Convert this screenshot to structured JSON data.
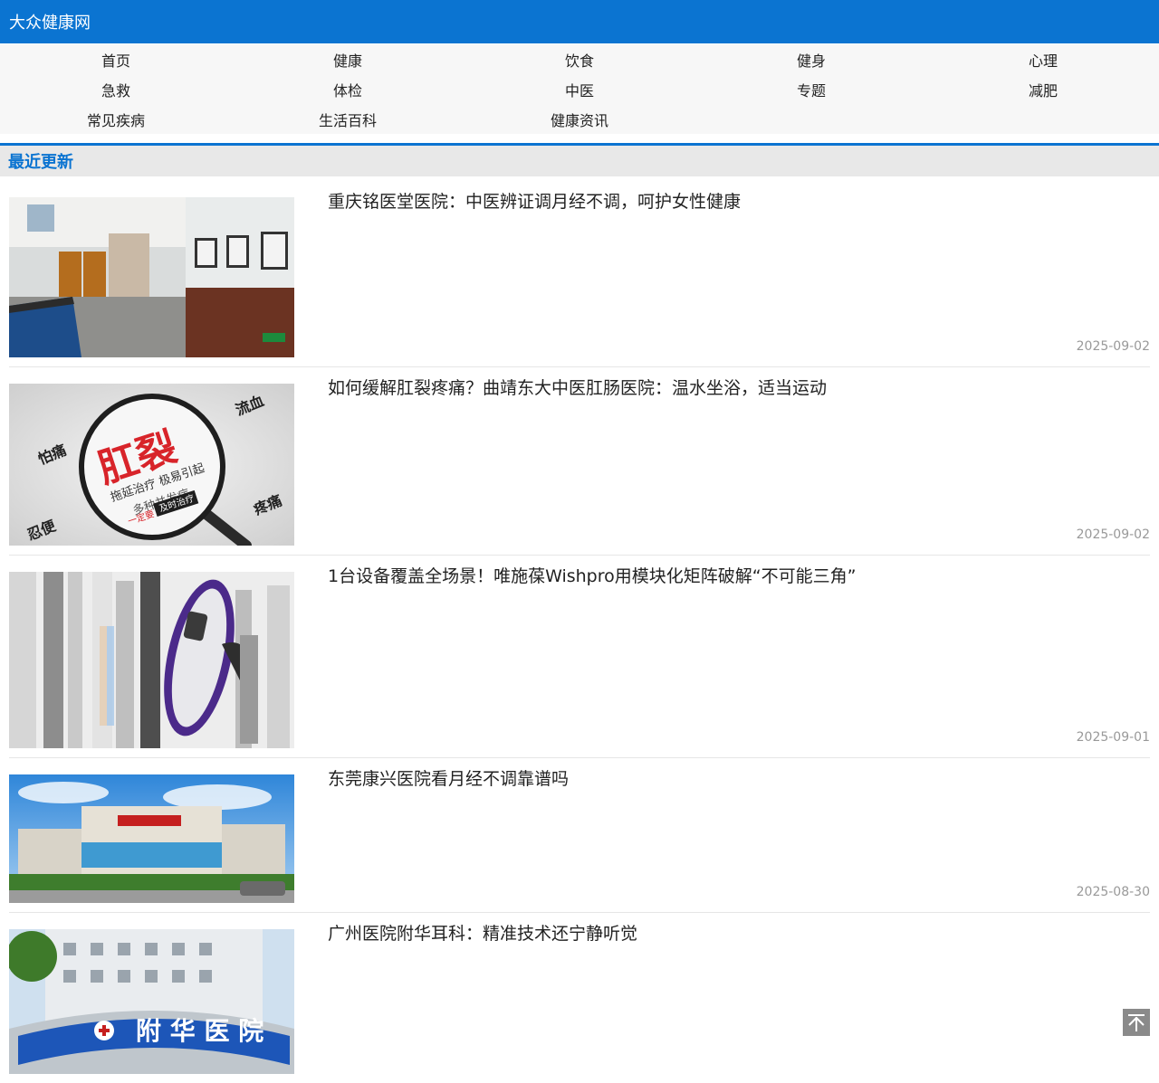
{
  "site": {
    "title": "大众健康网"
  },
  "nav": {
    "items": [
      "首页",
      "健康",
      "饮食",
      "健身",
      "心理",
      "急救",
      "体检",
      "中医",
      "专题",
      "减肥",
      "常见疾病",
      "生活百科",
      "健康资讯"
    ]
  },
  "section": {
    "title": "最近更新"
  },
  "articles": [
    {
      "title": "重庆铭医堂医院：中医辨证调月经不调，呵护女性健康",
      "date": "2025-09-02"
    },
    {
      "title": "如何缓解肛裂疼痛？曲靖东大中医肛肠医院：温水坐浴，适当运动",
      "date": "2025-09-02",
      "image_text": {
        "main": "肛裂",
        "tag1": "流血",
        "tag2": "怕痛",
        "tag3": "疼痛",
        "tag4": "忍便",
        "line1": "拖延治疗 极易引起",
        "line2": "多种并发症",
        "line3": "一定要",
        "badge": "及时治疗"
      }
    },
    {
      "title": "1台设备覆盖全场景！唯施葆Wishpro用模块化矩阵破解“不可能三角”",
      "date": "2025-09-01"
    },
    {
      "title": "东莞康兴医院看月经不调靠谱吗",
      "date": "2025-08-30"
    },
    {
      "title": "广州医院附华耳科：精准技术还宁静听觉",
      "date": "",
      "image_text": {
        "sign": "附 华 医 院"
      }
    }
  ],
  "colors": {
    "brand": "#0b74d1",
    "date": "#999999"
  },
  "icons": {
    "back_to_top": "arrow-up-icon"
  }
}
